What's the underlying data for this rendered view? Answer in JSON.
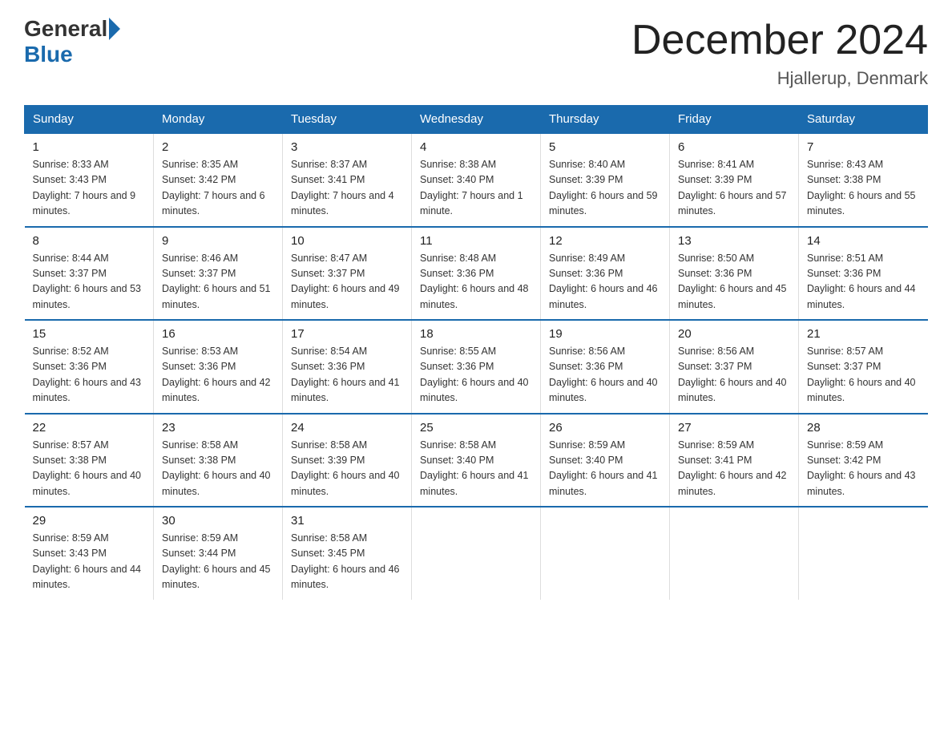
{
  "header": {
    "logo": {
      "general": "General",
      "blue": "Blue"
    },
    "title": "December 2024",
    "location": "Hjallerup, Denmark"
  },
  "days_of_week": [
    "Sunday",
    "Monday",
    "Tuesday",
    "Wednesday",
    "Thursday",
    "Friday",
    "Saturday"
  ],
  "weeks": [
    [
      {
        "day": "1",
        "sunrise": "8:33 AM",
        "sunset": "3:43 PM",
        "daylight": "7 hours and 9 minutes."
      },
      {
        "day": "2",
        "sunrise": "8:35 AM",
        "sunset": "3:42 PM",
        "daylight": "7 hours and 6 minutes."
      },
      {
        "day": "3",
        "sunrise": "8:37 AM",
        "sunset": "3:41 PM",
        "daylight": "7 hours and 4 minutes."
      },
      {
        "day": "4",
        "sunrise": "8:38 AM",
        "sunset": "3:40 PM",
        "daylight": "7 hours and 1 minute."
      },
      {
        "day": "5",
        "sunrise": "8:40 AM",
        "sunset": "3:39 PM",
        "daylight": "6 hours and 59 minutes."
      },
      {
        "day": "6",
        "sunrise": "8:41 AM",
        "sunset": "3:39 PM",
        "daylight": "6 hours and 57 minutes."
      },
      {
        "day": "7",
        "sunrise": "8:43 AM",
        "sunset": "3:38 PM",
        "daylight": "6 hours and 55 minutes."
      }
    ],
    [
      {
        "day": "8",
        "sunrise": "8:44 AM",
        "sunset": "3:37 PM",
        "daylight": "6 hours and 53 minutes."
      },
      {
        "day": "9",
        "sunrise": "8:46 AM",
        "sunset": "3:37 PM",
        "daylight": "6 hours and 51 minutes."
      },
      {
        "day": "10",
        "sunrise": "8:47 AM",
        "sunset": "3:37 PM",
        "daylight": "6 hours and 49 minutes."
      },
      {
        "day": "11",
        "sunrise": "8:48 AM",
        "sunset": "3:36 PM",
        "daylight": "6 hours and 48 minutes."
      },
      {
        "day": "12",
        "sunrise": "8:49 AM",
        "sunset": "3:36 PM",
        "daylight": "6 hours and 46 minutes."
      },
      {
        "day": "13",
        "sunrise": "8:50 AM",
        "sunset": "3:36 PM",
        "daylight": "6 hours and 45 minutes."
      },
      {
        "day": "14",
        "sunrise": "8:51 AM",
        "sunset": "3:36 PM",
        "daylight": "6 hours and 44 minutes."
      }
    ],
    [
      {
        "day": "15",
        "sunrise": "8:52 AM",
        "sunset": "3:36 PM",
        "daylight": "6 hours and 43 minutes."
      },
      {
        "day": "16",
        "sunrise": "8:53 AM",
        "sunset": "3:36 PM",
        "daylight": "6 hours and 42 minutes."
      },
      {
        "day": "17",
        "sunrise": "8:54 AM",
        "sunset": "3:36 PM",
        "daylight": "6 hours and 41 minutes."
      },
      {
        "day": "18",
        "sunrise": "8:55 AM",
        "sunset": "3:36 PM",
        "daylight": "6 hours and 40 minutes."
      },
      {
        "day": "19",
        "sunrise": "8:56 AM",
        "sunset": "3:36 PM",
        "daylight": "6 hours and 40 minutes."
      },
      {
        "day": "20",
        "sunrise": "8:56 AM",
        "sunset": "3:37 PM",
        "daylight": "6 hours and 40 minutes."
      },
      {
        "day": "21",
        "sunrise": "8:57 AM",
        "sunset": "3:37 PM",
        "daylight": "6 hours and 40 minutes."
      }
    ],
    [
      {
        "day": "22",
        "sunrise": "8:57 AM",
        "sunset": "3:38 PM",
        "daylight": "6 hours and 40 minutes."
      },
      {
        "day": "23",
        "sunrise": "8:58 AM",
        "sunset": "3:38 PM",
        "daylight": "6 hours and 40 minutes."
      },
      {
        "day": "24",
        "sunrise": "8:58 AM",
        "sunset": "3:39 PM",
        "daylight": "6 hours and 40 minutes."
      },
      {
        "day": "25",
        "sunrise": "8:58 AM",
        "sunset": "3:40 PM",
        "daylight": "6 hours and 41 minutes."
      },
      {
        "day": "26",
        "sunrise": "8:59 AM",
        "sunset": "3:40 PM",
        "daylight": "6 hours and 41 minutes."
      },
      {
        "day": "27",
        "sunrise": "8:59 AM",
        "sunset": "3:41 PM",
        "daylight": "6 hours and 42 minutes."
      },
      {
        "day": "28",
        "sunrise": "8:59 AM",
        "sunset": "3:42 PM",
        "daylight": "6 hours and 43 minutes."
      }
    ],
    [
      {
        "day": "29",
        "sunrise": "8:59 AM",
        "sunset": "3:43 PM",
        "daylight": "6 hours and 44 minutes."
      },
      {
        "day": "30",
        "sunrise": "8:59 AM",
        "sunset": "3:44 PM",
        "daylight": "6 hours and 45 minutes."
      },
      {
        "day": "31",
        "sunrise": "8:58 AM",
        "sunset": "3:45 PM",
        "daylight": "6 hours and 46 minutes."
      },
      null,
      null,
      null,
      null
    ]
  ],
  "labels": {
    "sunrise": "Sunrise:",
    "sunset": "Sunset:",
    "daylight": "Daylight:"
  }
}
